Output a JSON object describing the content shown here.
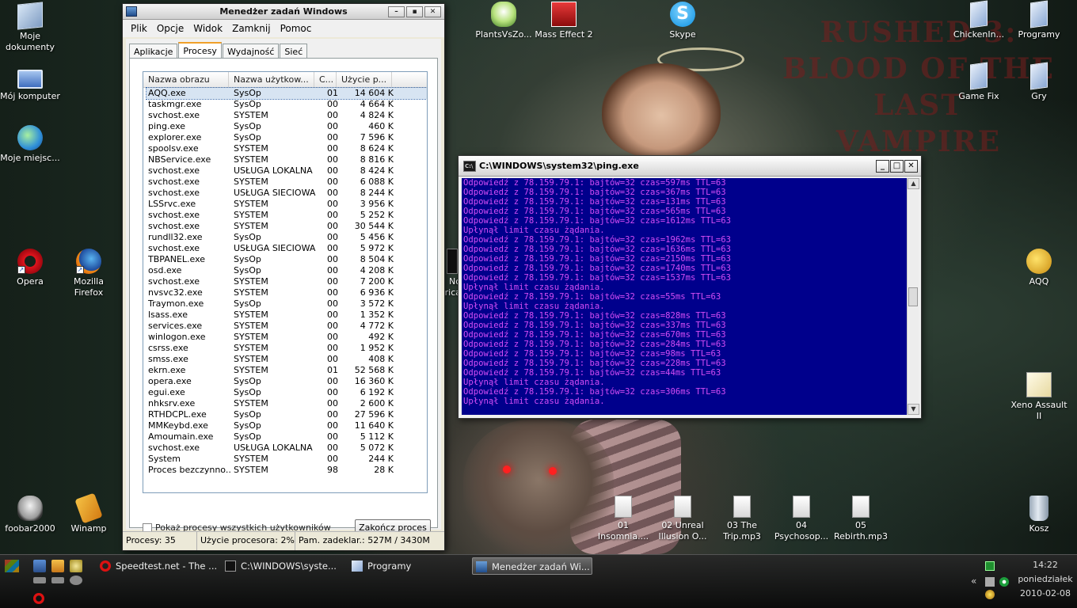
{
  "desktop": {
    "left_icons": [
      {
        "label": "Moje dokumenty",
        "icon": "documents-icon"
      },
      {
        "label": "Mój komputer",
        "icon": "computer-icon"
      },
      {
        "label": "Moje miejsc...",
        "icon": "network-globe-icon"
      },
      {
        "label": "Opera",
        "icon": "opera-icon"
      },
      {
        "label": "Mozilla Firefox",
        "icon": "firefox-icon"
      },
      {
        "label": "foobar2000",
        "icon": "foobar-skull-icon"
      },
      {
        "label": "Winamp",
        "icon": "winamp-icon"
      }
    ],
    "top_icons": [
      {
        "label": "PlantsVsZo...",
        "icon": "plants-icon"
      },
      {
        "label": "Mass Effect 2",
        "icon": "mass-effect-icon"
      },
      {
        "label": "Skype",
        "icon": "skype-icon"
      }
    ],
    "right_icons": [
      {
        "label": "ChickenIn...",
        "icon": "folder-icon"
      },
      {
        "label": "Programy",
        "icon": "folder-icon"
      },
      {
        "label": "Game Fix",
        "icon": "folder-icon"
      },
      {
        "label": "Gry",
        "icon": "folder-icon"
      },
      {
        "label": "AQQ",
        "icon": "aqq-keys-icon"
      },
      {
        "label": "Xeno Assault II",
        "icon": "rocket-icon"
      },
      {
        "label": "Kosz",
        "icon": "recycle-bin-icon"
      }
    ],
    "audio_files": [
      {
        "label": "01 Insomnia...."
      },
      {
        "label": "02 Unreal Illusion O..."
      },
      {
        "label": "03 The Trip.mp3"
      },
      {
        "label": "04 Psychosop..."
      },
      {
        "label": "05 Rebirth.mp3"
      }
    ],
    "partial_icon_text": {
      "line1": "No",
      "line2": "rica"
    },
    "wallpaper_text": {
      "line1": "RUSHED 3:",
      "line2": "BLOOD OF THE LAST",
      "line3": "VAMPIRE"
    },
    "skype_glyph": "S"
  },
  "taskmgr": {
    "title": "Menedżer zadań Windows",
    "menu": [
      "Plik",
      "Opcje",
      "Widok",
      "Zamknij",
      "Pomoc"
    ],
    "window_buttons": {
      "min": "–",
      "max": "▪",
      "close": "✕"
    },
    "tabs": [
      "Aplikacje",
      "Procesy",
      "Wydajność",
      "Sieć"
    ],
    "active_tab": 1,
    "columns": [
      "Nazwa obrazu",
      "Nazwa użytkow...",
      "C...",
      "Użycie p..."
    ],
    "processes": [
      [
        "AQQ.exe",
        "SysOp",
        "01",
        "14 604 K"
      ],
      [
        "taskmgr.exe",
        "SysOp",
        "00",
        "4 664 K"
      ],
      [
        "svchost.exe",
        "SYSTEM",
        "00",
        "4 824 K"
      ],
      [
        "ping.exe",
        "SysOp",
        "00",
        "460 K"
      ],
      [
        "explorer.exe",
        "SysOp",
        "00",
        "7 596 K"
      ],
      [
        "spoolsv.exe",
        "SYSTEM",
        "00",
        "8 624 K"
      ],
      [
        "NBService.exe",
        "SYSTEM",
        "00",
        "8 816 K"
      ],
      [
        "svchost.exe",
        "USŁUGA LOKALNA",
        "00",
        "8 424 K"
      ],
      [
        "svchost.exe",
        "SYSTEM",
        "00",
        "6 088 K"
      ],
      [
        "svchost.exe",
        "USŁUGA SIECIOWA",
        "00",
        "8 244 K"
      ],
      [
        "LSSrvc.exe",
        "SYSTEM",
        "00",
        "3 956 K"
      ],
      [
        "svchost.exe",
        "SYSTEM",
        "00",
        "5 252 K"
      ],
      [
        "svchost.exe",
        "SYSTEM",
        "00",
        "30 544 K"
      ],
      [
        "rundll32.exe",
        "SysOp",
        "00",
        "5 456 K"
      ],
      [
        "svchost.exe",
        "USŁUGA SIECIOWA",
        "00",
        "5 972 K"
      ],
      [
        "TBPANEL.exe",
        "SysOp",
        "00",
        "8 504 K"
      ],
      [
        "osd.exe",
        "SysOp",
        "00",
        "4 208 K"
      ],
      [
        "svchost.exe",
        "SYSTEM",
        "00",
        "7 200 K"
      ],
      [
        "nvsvc32.exe",
        "SYSTEM",
        "00",
        "6 936 K"
      ],
      [
        "Traymon.exe",
        "SysOp",
        "00",
        "3 572 K"
      ],
      [
        "lsass.exe",
        "SYSTEM",
        "00",
        "1 352 K"
      ],
      [
        "services.exe",
        "SYSTEM",
        "00",
        "4 772 K"
      ],
      [
        "winlogon.exe",
        "SYSTEM",
        "00",
        "492 K"
      ],
      [
        "csrss.exe",
        "SYSTEM",
        "00",
        "1 952 K"
      ],
      [
        "smss.exe",
        "SYSTEM",
        "00",
        "408 K"
      ],
      [
        "ekrn.exe",
        "SYSTEM",
        "01",
        "52 568 K"
      ],
      [
        "opera.exe",
        "SysOp",
        "00",
        "16 360 K"
      ],
      [
        "egui.exe",
        "SysOp",
        "00",
        "6 192 K"
      ],
      [
        "nhksrv.exe",
        "SYSTEM",
        "00",
        "2 600 K"
      ],
      [
        "RTHDCPL.exe",
        "SysOp",
        "00",
        "27 596 K"
      ],
      [
        "MMKeybd.exe",
        "SysOp",
        "00",
        "11 640 K"
      ],
      [
        "Amoumain.exe",
        "SysOp",
        "00",
        "5 112 K"
      ],
      [
        "svchost.exe",
        "USŁUGA LOKALNA",
        "00",
        "5 072 K"
      ],
      [
        "System",
        "SYSTEM",
        "00",
        "244 K"
      ],
      [
        "Proces bezczynno...",
        "SYSTEM",
        "98",
        "28 K"
      ]
    ],
    "show_all_label": "Pokaż procesy wszystkich użytkowników",
    "end_button": "Zakończ proces",
    "status": {
      "procs": "Procesy: 35",
      "cpu": "Użycie procesora: 2%",
      "mem": "Pam. zadeklar.: 527M / 3430M"
    }
  },
  "cmd": {
    "title": "C:\\WINDOWS\\system32\\ping.exe",
    "icon_text": "C:\\",
    "window_buttons": {
      "min": "_",
      "max": "□",
      "close": "✕"
    },
    "scroll": {
      "up": "▲",
      "down": "▼"
    },
    "lines": [
      "Odpowiedź z 78.159.79.1: bajtów=32 czas=597ms TTL=63",
      "Odpowiedź z 78.159.79.1: bajtów=32 czas=367ms TTL=63",
      "Odpowiedź z 78.159.79.1: bajtów=32 czas=131ms TTL=63",
      "Odpowiedź z 78.159.79.1: bajtów=32 czas=565ms TTL=63",
      "Odpowiedź z 78.159.79.1: bajtów=32 czas=1612ms TTL=63",
      "Upłynął limit czasu żądania.",
      "Odpowiedź z 78.159.79.1: bajtów=32 czas=1962ms TTL=63",
      "Odpowiedź z 78.159.79.1: bajtów=32 czas=1636ms TTL=63",
      "Odpowiedź z 78.159.79.1: bajtów=32 czas=2150ms TTL=63",
      "Odpowiedź z 78.159.79.1: bajtów=32 czas=1740ms TTL=63",
      "Odpowiedź z 78.159.79.1: bajtów=32 czas=1537ms TTL=63",
      "Upłynął limit czasu żądania.",
      "Odpowiedź z 78.159.79.1: bajtów=32 czas=55ms TTL=63",
      "Upłynął limit czasu żądania.",
      "Odpowiedź z 78.159.79.1: bajtów=32 czas=828ms TTL=63",
      "Odpowiedź z 78.159.79.1: bajtów=32 czas=337ms TTL=63",
      "Odpowiedź z 78.159.79.1: bajtów=32 czas=670ms TTL=63",
      "Odpowiedź z 78.159.79.1: bajtów=32 czas=284ms TTL=63",
      "Odpowiedź z 78.159.79.1: bajtów=32 czas=98ms TTL=63",
      "Odpowiedź z 78.159.79.1: bajtów=32 czas=228ms TTL=63",
      "Odpowiedź z 78.159.79.1: bajtów=32 czas=44ms TTL=63",
      "Upłynął limit czasu żądania.",
      "Odpowiedź z 78.159.79.1: bajtów=32 czas=306ms TTL=63",
      "Upłynął limit czasu żądania."
    ],
    "text_color": "#d44cf5",
    "bg_color": "#00008c"
  },
  "taskbar": {
    "buttons": [
      {
        "label": "Speedtest.net - The ...",
        "icon": "opera-icon"
      },
      {
        "label": "C:\\WINDOWS\\syste...",
        "icon": "console-icon"
      },
      {
        "label": "Programy",
        "icon": "folder-icon"
      },
      {
        "label": "Menedżer zadań Wi...",
        "icon": "taskmgr-icon"
      }
    ],
    "clock": {
      "time": "14:22",
      "day": "poniedziałek",
      "date": "2010-02-08"
    },
    "chevron": "«"
  }
}
